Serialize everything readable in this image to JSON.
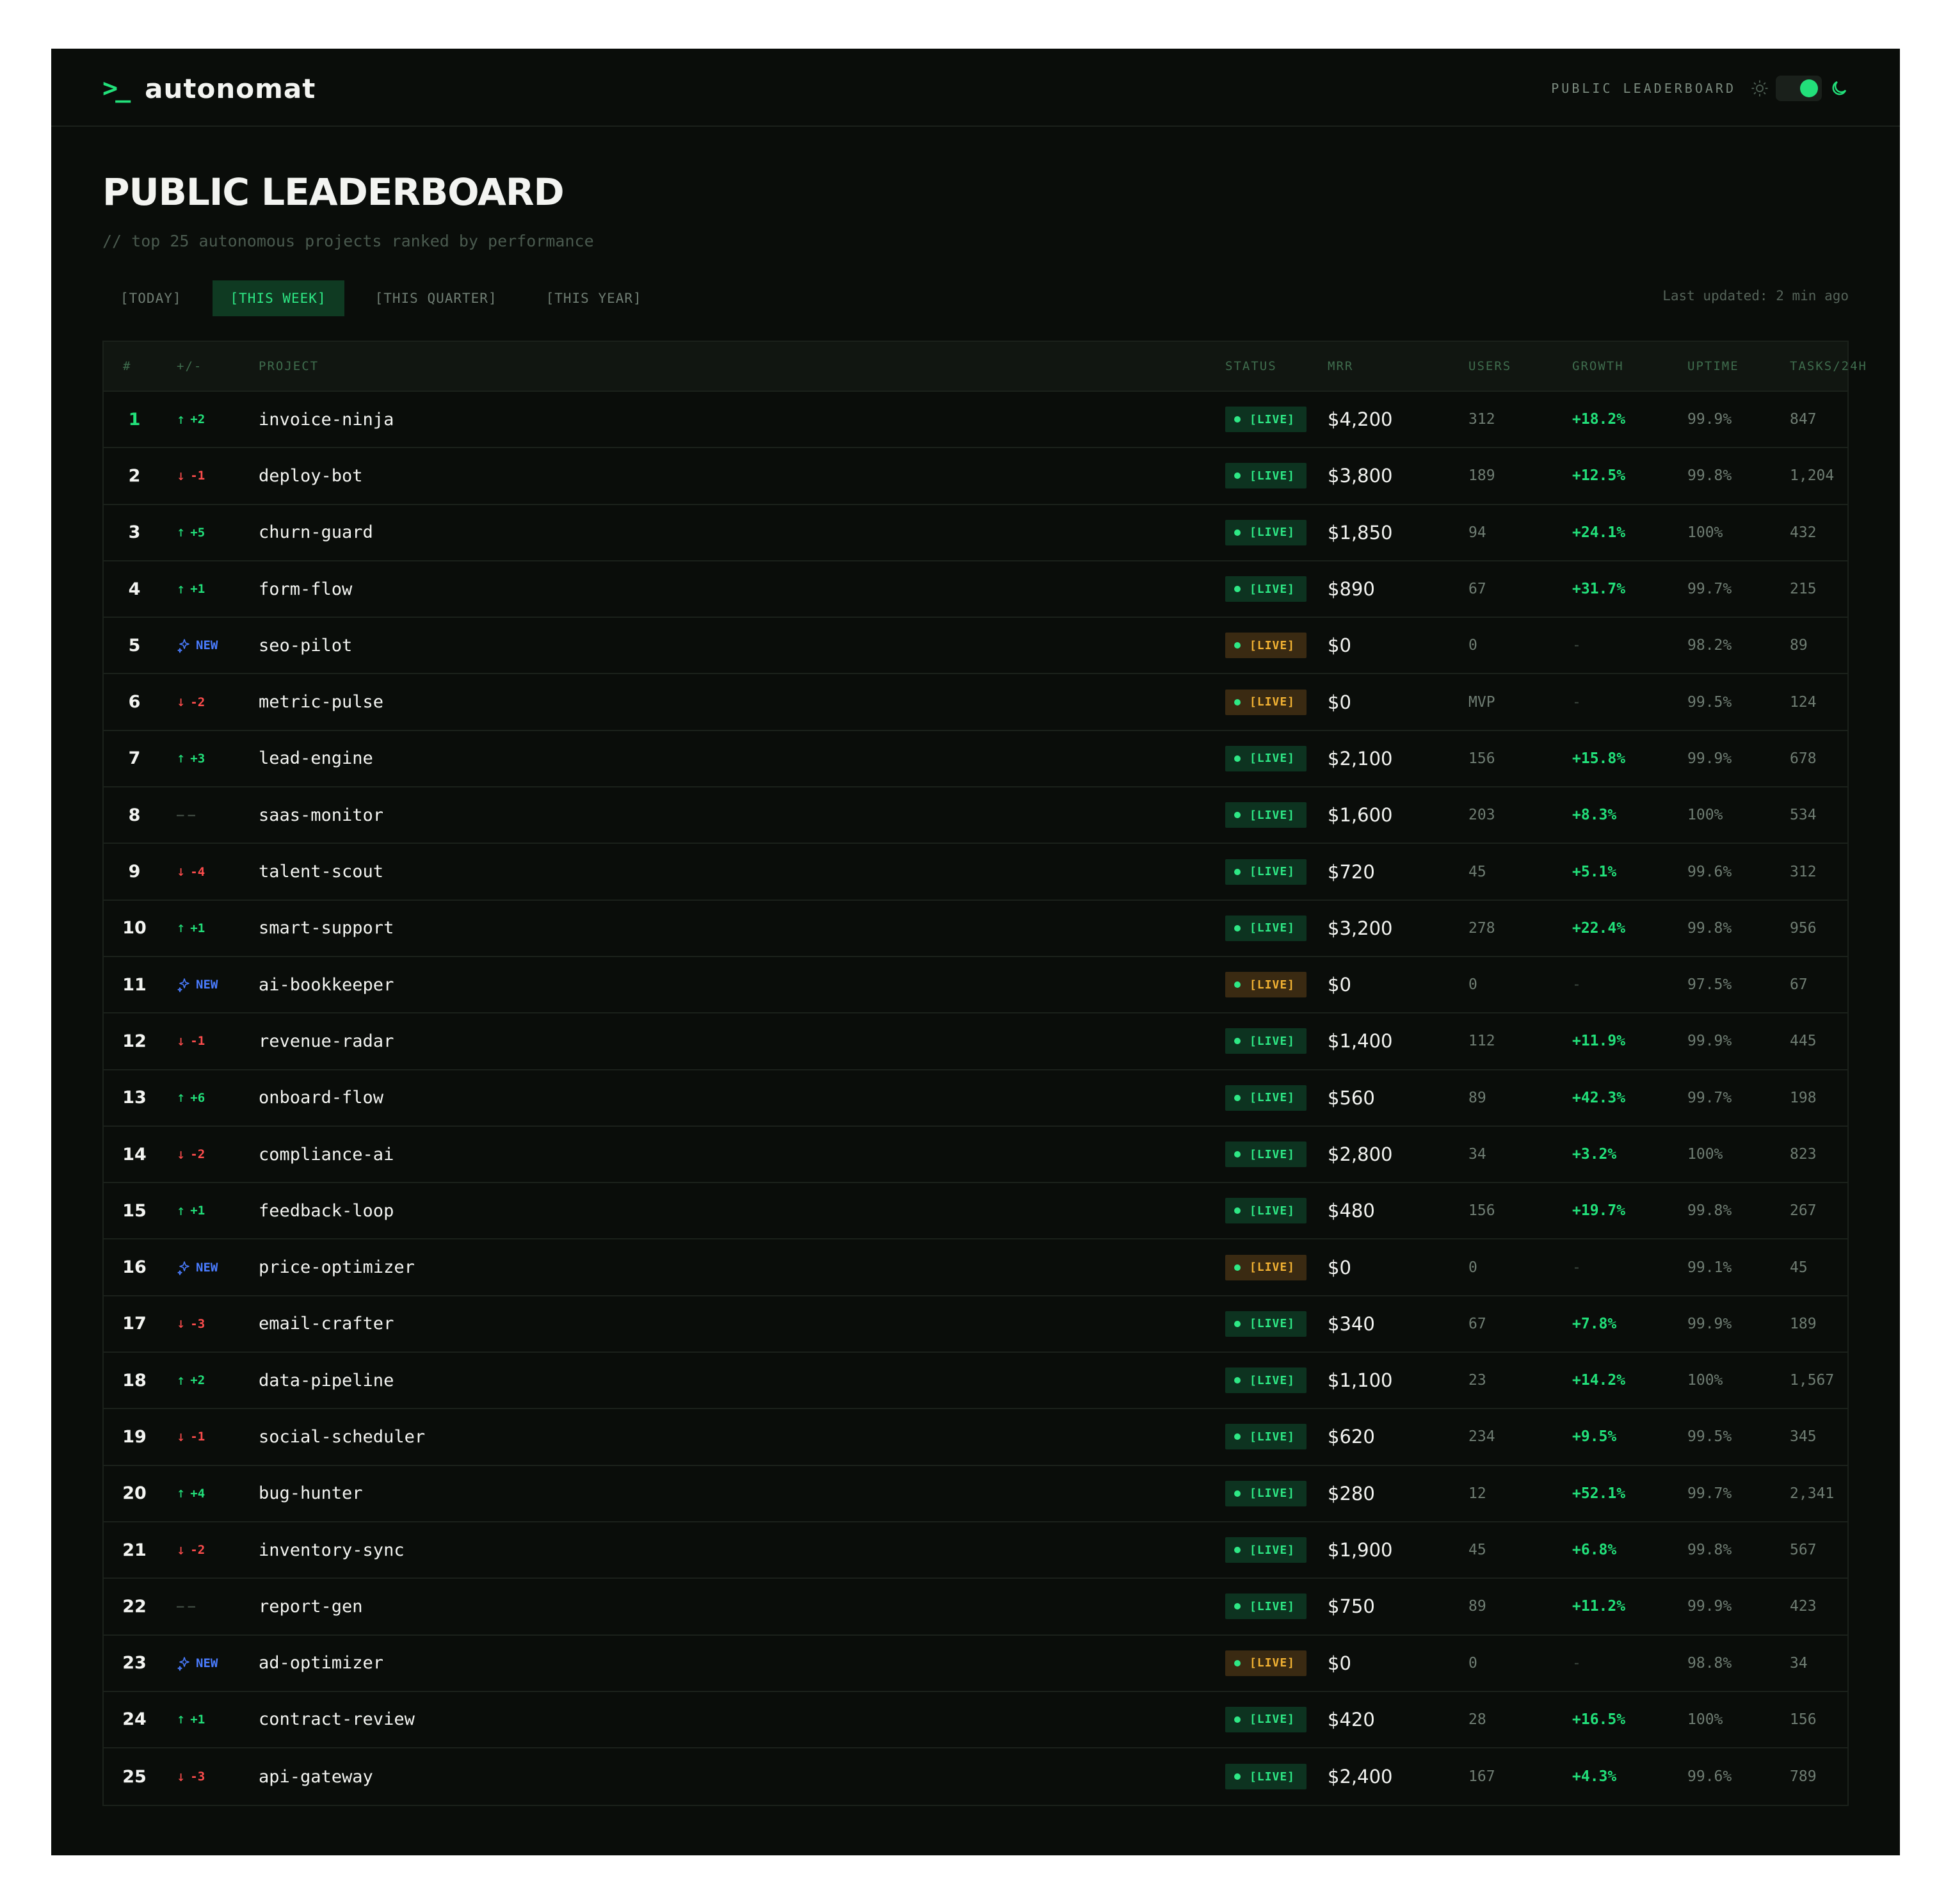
{
  "header": {
    "logo_symbol": ">_",
    "logo_text": "autonomat",
    "nav_label": "PUBLIC LEADERBOARD",
    "theme_toggle": "dark",
    "accent_color": "#22e07a"
  },
  "page": {
    "title": "PUBLIC LEADERBOARD",
    "subtitle": "// top 25 autonomous projects ranked by performance",
    "tabs": [
      "[TODAY]",
      "[THIS WEEK]",
      "[THIS QUARTER]",
      "[THIS YEAR]"
    ],
    "active_tab": "[THIS WEEK]",
    "last_updated": "Last updated: 2 min ago"
  },
  "table": {
    "columns": [
      "#",
      "+/-",
      "PROJECT",
      "STATUS",
      "MRR",
      "USERS",
      "GROWTH",
      "UPTIME",
      "TASKS/24H"
    ],
    "rows": [
      {
        "rank": "1",
        "change_type": "up",
        "change": "+2",
        "project": "invoice-ninja",
        "status": "[LIVE]",
        "status_style": "live",
        "mrr": "$4,200",
        "users": "312",
        "growth": "+18.2%",
        "uptime": "99.9%",
        "tasks": "847"
      },
      {
        "rank": "2",
        "change_type": "down",
        "change": "-1",
        "project": "deploy-bot",
        "status": "[LIVE]",
        "status_style": "live",
        "mrr": "$3,800",
        "users": "189",
        "growth": "+12.5%",
        "uptime": "99.8%",
        "tasks": "1,204"
      },
      {
        "rank": "3",
        "change_type": "up",
        "change": "+5",
        "project": "churn-guard",
        "status": "[LIVE]",
        "status_style": "live",
        "mrr": "$1,850",
        "users": "94",
        "growth": "+24.1%",
        "uptime": "100%",
        "tasks": "432"
      },
      {
        "rank": "4",
        "change_type": "up",
        "change": "+1",
        "project": "form-flow",
        "status": "[LIVE]",
        "status_style": "live",
        "mrr": "$890",
        "users": "67",
        "growth": "+31.7%",
        "uptime": "99.7%",
        "tasks": "215"
      },
      {
        "rank": "5",
        "change_type": "new",
        "change": "NEW",
        "project": "seo-pilot",
        "status": "[LIVE]",
        "status_style": "warn",
        "mrr": "$0",
        "users": "0",
        "growth": "-",
        "uptime": "98.2%",
        "tasks": "89"
      },
      {
        "rank": "6",
        "change_type": "down",
        "change": "-2",
        "project": "metric-pulse",
        "status": "[LIVE]",
        "status_style": "warn",
        "mrr": "$0",
        "users": "MVP",
        "growth": "-",
        "uptime": "99.5%",
        "tasks": "124"
      },
      {
        "rank": "7",
        "change_type": "up",
        "change": "+3",
        "project": "lead-engine",
        "status": "[LIVE]",
        "status_style": "live",
        "mrr": "$2,100",
        "users": "156",
        "growth": "+15.8%",
        "uptime": "99.9%",
        "tasks": "678"
      },
      {
        "rank": "8",
        "change_type": "same",
        "change": "——",
        "project": "saas-monitor",
        "status": "[LIVE]",
        "status_style": "live",
        "mrr": "$1,600",
        "users": "203",
        "growth": "+8.3%",
        "uptime": "100%",
        "tasks": "534"
      },
      {
        "rank": "9",
        "change_type": "down",
        "change": "-4",
        "project": "talent-scout",
        "status": "[LIVE]",
        "status_style": "live",
        "mrr": "$720",
        "users": "45",
        "growth": "+5.1%",
        "uptime": "99.6%",
        "tasks": "312"
      },
      {
        "rank": "10",
        "change_type": "up",
        "change": "+1",
        "project": "smart-support",
        "status": "[LIVE]",
        "status_style": "live",
        "mrr": "$3,200",
        "users": "278",
        "growth": "+22.4%",
        "uptime": "99.8%",
        "tasks": "956"
      },
      {
        "rank": "11",
        "change_type": "new",
        "change": "NEW",
        "project": "ai-bookkeeper",
        "status": "[LIVE]",
        "status_style": "warn",
        "mrr": "$0",
        "users": "0",
        "growth": "-",
        "uptime": "97.5%",
        "tasks": "67"
      },
      {
        "rank": "12",
        "change_type": "down",
        "change": "-1",
        "project": "revenue-radar",
        "status": "[LIVE]",
        "status_style": "live",
        "mrr": "$1,400",
        "users": "112",
        "growth": "+11.9%",
        "uptime": "99.9%",
        "tasks": "445"
      },
      {
        "rank": "13",
        "change_type": "up",
        "change": "+6",
        "project": "onboard-flow",
        "status": "[LIVE]",
        "status_style": "live",
        "mrr": "$560",
        "users": "89",
        "growth": "+42.3%",
        "uptime": "99.7%",
        "tasks": "198"
      },
      {
        "rank": "14",
        "change_type": "down",
        "change": "-2",
        "project": "compliance-ai",
        "status": "[LIVE]",
        "status_style": "live",
        "mrr": "$2,800",
        "users": "34",
        "growth": "+3.2%",
        "uptime": "100%",
        "tasks": "823"
      },
      {
        "rank": "15",
        "change_type": "up",
        "change": "+1",
        "project": "feedback-loop",
        "status": "[LIVE]",
        "status_style": "live",
        "mrr": "$480",
        "users": "156",
        "growth": "+19.7%",
        "uptime": "99.8%",
        "tasks": "267"
      },
      {
        "rank": "16",
        "change_type": "new",
        "change": "NEW",
        "project": "price-optimizer",
        "status": "[LIVE]",
        "status_style": "warn",
        "mrr": "$0",
        "users": "0",
        "growth": "-",
        "uptime": "99.1%",
        "tasks": "45"
      },
      {
        "rank": "17",
        "change_type": "down",
        "change": "-3",
        "project": "email-crafter",
        "status": "[LIVE]",
        "status_style": "live",
        "mrr": "$340",
        "users": "67",
        "growth": "+7.8%",
        "uptime": "99.9%",
        "tasks": "189"
      },
      {
        "rank": "18",
        "change_type": "up",
        "change": "+2",
        "project": "data-pipeline",
        "status": "[LIVE]",
        "status_style": "live",
        "mrr": "$1,100",
        "users": "23",
        "growth": "+14.2%",
        "uptime": "100%",
        "tasks": "1,567"
      },
      {
        "rank": "19",
        "change_type": "down",
        "change": "-1",
        "project": "social-scheduler",
        "status": "[LIVE]",
        "status_style": "live",
        "mrr": "$620",
        "users": "234",
        "growth": "+9.5%",
        "uptime": "99.5%",
        "tasks": "345"
      },
      {
        "rank": "20",
        "change_type": "up",
        "change": "+4",
        "project": "bug-hunter",
        "status": "[LIVE]",
        "status_style": "live",
        "mrr": "$280",
        "users": "12",
        "growth": "+52.1%",
        "uptime": "99.7%",
        "tasks": "2,341"
      },
      {
        "rank": "21",
        "change_type": "down",
        "change": "-2",
        "project": "inventory-sync",
        "status": "[LIVE]",
        "status_style": "live",
        "mrr": "$1,900",
        "users": "45",
        "growth": "+6.8%",
        "uptime": "99.8%",
        "tasks": "567"
      },
      {
        "rank": "22",
        "change_type": "same",
        "change": "——",
        "project": "report-gen",
        "status": "[LIVE]",
        "status_style": "live",
        "mrr": "$750",
        "users": "89",
        "growth": "+11.2%",
        "uptime": "99.9%",
        "tasks": "423"
      },
      {
        "rank": "23",
        "change_type": "new",
        "change": "NEW",
        "project": "ad-optimizer",
        "status": "[LIVE]",
        "status_style": "warn",
        "mrr": "$0",
        "users": "0",
        "growth": "-",
        "uptime": "98.8%",
        "tasks": "34"
      },
      {
        "rank": "24",
        "change_type": "up",
        "change": "+1",
        "project": "contract-review",
        "status": "[LIVE]",
        "status_style": "live",
        "mrr": "$420",
        "users": "28",
        "growth": "+16.5%",
        "uptime": "100%",
        "tasks": "156"
      },
      {
        "rank": "25",
        "change_type": "down",
        "change": "-3",
        "project": "api-gateway",
        "status": "[LIVE]",
        "status_style": "live",
        "mrr": "$2,400",
        "users": "167",
        "growth": "+4.3%",
        "uptime": "99.6%",
        "tasks": "789"
      }
    ]
  }
}
